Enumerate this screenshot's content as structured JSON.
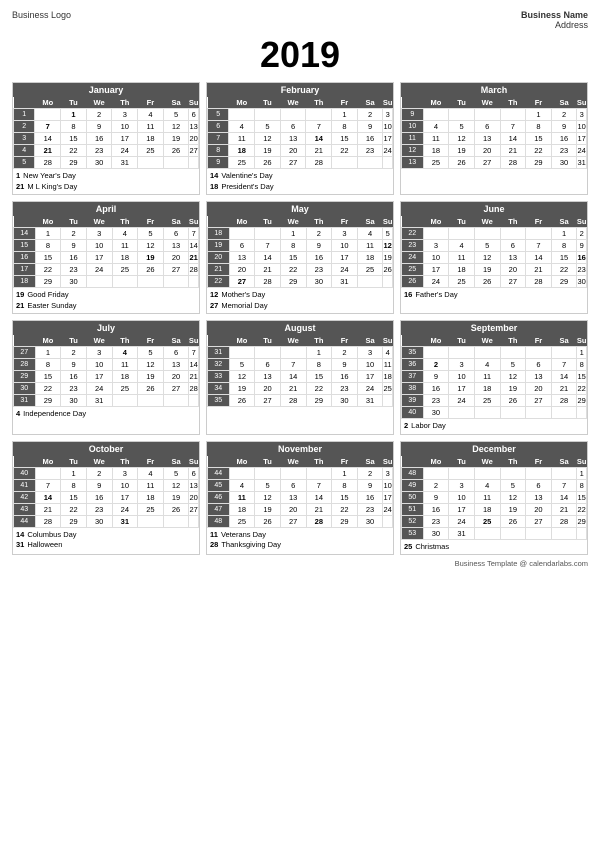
{
  "header": {
    "logo": "Business Logo",
    "name": "Business Name",
    "address": "Address",
    "year": "2019"
  },
  "footer": "Business Template @ calendarlabs.com",
  "months": [
    {
      "name": "January",
      "weeks": [
        [
          "",
          "Mo",
          "Tu",
          "We",
          "Th",
          "Fr",
          "Sa",
          "Su"
        ],
        [
          "1",
          "",
          "1",
          "2",
          "3",
          "4",
          "5",
          "6"
        ],
        [
          "2",
          "7",
          "8",
          "9",
          "10",
          "11",
          "12",
          "13"
        ],
        [
          "3",
          "14",
          "15",
          "16",
          "17",
          "18",
          "19",
          "20"
        ],
        [
          "4",
          "21",
          "22",
          "23",
          "24",
          "25",
          "26",
          "27"
        ],
        [
          "5",
          "28",
          "29",
          "30",
          "31",
          "",
          "",
          ""
        ]
      ],
      "holidays": [
        {
          "num": "1",
          "name": "New Year's Day"
        },
        {
          "num": "21",
          "name": "M L King's Day"
        }
      ]
    },
    {
      "name": "February",
      "weeks": [
        [
          "",
          "Mo",
          "Tu",
          "We",
          "Th",
          "Fr",
          "Sa",
          "Su"
        ],
        [
          "5",
          "",
          "",
          "",
          "",
          "1",
          "2",
          "3"
        ],
        [
          "6",
          "4",
          "5",
          "6",
          "7",
          "8",
          "9",
          "10"
        ],
        [
          "7",
          "11",
          "12",
          "13",
          "14",
          "15",
          "16",
          "17"
        ],
        [
          "8",
          "18",
          "19",
          "20",
          "21",
          "22",
          "23",
          "24"
        ],
        [
          "9",
          "25",
          "26",
          "27",
          "28",
          "",
          "",
          ""
        ]
      ],
      "holidays": [
        {
          "num": "14",
          "name": "Valentine's Day"
        },
        {
          "num": "18",
          "name": "President's Day"
        }
      ]
    },
    {
      "name": "March",
      "weeks": [
        [
          "",
          "Mo",
          "Tu",
          "We",
          "Th",
          "Fr",
          "Sa",
          "Su"
        ],
        [
          "9",
          "",
          "",
          "",
          "",
          "1",
          "2",
          "3"
        ],
        [
          "10",
          "4",
          "5",
          "6",
          "7",
          "8",
          "9",
          "10"
        ],
        [
          "11",
          "11",
          "12",
          "13",
          "14",
          "15",
          "16",
          "17"
        ],
        [
          "12",
          "18",
          "19",
          "20",
          "21",
          "22",
          "23",
          "24"
        ],
        [
          "13",
          "25",
          "26",
          "27",
          "28",
          "29",
          "30",
          "31"
        ]
      ],
      "holidays": []
    },
    {
      "name": "April",
      "weeks": [
        [
          "",
          "Mo",
          "Tu",
          "We",
          "Th",
          "Fr",
          "Sa",
          "Su"
        ],
        [
          "14",
          "1",
          "2",
          "3",
          "4",
          "5",
          "6",
          "7"
        ],
        [
          "15",
          "8",
          "9",
          "10",
          "11",
          "12",
          "13",
          "14"
        ],
        [
          "16",
          "15",
          "16",
          "17",
          "18",
          "19",
          "20",
          "21"
        ],
        [
          "17",
          "22",
          "23",
          "24",
          "25",
          "26",
          "27",
          "28"
        ],
        [
          "18",
          "29",
          "30",
          "",
          "",
          "",
          "",
          ""
        ]
      ],
      "holidays": [
        {
          "num": "19",
          "name": "Good Friday"
        },
        {
          "num": "21",
          "name": "Easter Sunday"
        }
      ]
    },
    {
      "name": "May",
      "weeks": [
        [
          "",
          "Mo",
          "Tu",
          "We",
          "Th",
          "Fr",
          "Sa",
          "Su"
        ],
        [
          "18",
          "",
          "",
          "1",
          "2",
          "3",
          "4",
          "5"
        ],
        [
          "19",
          "6",
          "7",
          "8",
          "9",
          "10",
          "11",
          "12"
        ],
        [
          "20",
          "13",
          "14",
          "15",
          "16",
          "17",
          "18",
          "19"
        ],
        [
          "21",
          "20",
          "21",
          "22",
          "23",
          "24",
          "25",
          "26"
        ],
        [
          "22",
          "27",
          "28",
          "29",
          "30",
          "31",
          "",
          ""
        ]
      ],
      "holidays": [
        {
          "num": "12",
          "name": "Mother's Day"
        },
        {
          "num": "27",
          "name": "Memorial Day"
        }
      ]
    },
    {
      "name": "June",
      "weeks": [
        [
          "",
          "Mo",
          "Tu",
          "We",
          "Th",
          "Fr",
          "Sa",
          "Su"
        ],
        [
          "22",
          "",
          "",
          "",
          "",
          "",
          "1",
          "2"
        ],
        [
          "23",
          "3",
          "4",
          "5",
          "6",
          "7",
          "8",
          "9"
        ],
        [
          "24",
          "10",
          "11",
          "12",
          "13",
          "14",
          "15",
          "16"
        ],
        [
          "25",
          "17",
          "18",
          "19",
          "20",
          "21",
          "22",
          "23"
        ],
        [
          "26",
          "24",
          "25",
          "26",
          "27",
          "28",
          "29",
          "30"
        ]
      ],
      "holidays": [
        {
          "num": "16",
          "name": "Father's Day"
        }
      ]
    },
    {
      "name": "July",
      "weeks": [
        [
          "",
          "Mo",
          "Tu",
          "We",
          "Th",
          "Fr",
          "Sa",
          "Su"
        ],
        [
          "27",
          "1",
          "2",
          "3",
          "4",
          "5",
          "6",
          "7"
        ],
        [
          "28",
          "8",
          "9",
          "10",
          "11",
          "12",
          "13",
          "14"
        ],
        [
          "29",
          "15",
          "16",
          "17",
          "18",
          "19",
          "20",
          "21"
        ],
        [
          "30",
          "22",
          "23",
          "24",
          "25",
          "26",
          "27",
          "28"
        ],
        [
          "31",
          "29",
          "30",
          "31",
          "",
          "",
          "",
          ""
        ]
      ],
      "holidays": [
        {
          "num": "4",
          "name": "Independence Day"
        }
      ]
    },
    {
      "name": "August",
      "weeks": [
        [
          "",
          "Mo",
          "Tu",
          "We",
          "Th",
          "Fr",
          "Sa",
          "Su"
        ],
        [
          "31",
          "",
          "",
          "",
          "1",
          "2",
          "3",
          "4"
        ],
        [
          "32",
          "5",
          "6",
          "7",
          "8",
          "9",
          "10",
          "11"
        ],
        [
          "33",
          "12",
          "13",
          "14",
          "15",
          "16",
          "17",
          "18"
        ],
        [
          "34",
          "19",
          "20",
          "21",
          "22",
          "23",
          "24",
          "25"
        ],
        [
          "35",
          "26",
          "27",
          "28",
          "29",
          "30",
          "31",
          ""
        ]
      ],
      "holidays": []
    },
    {
      "name": "September",
      "weeks": [
        [
          "",
          "Mo",
          "Tu",
          "We",
          "Th",
          "Fr",
          "Sa",
          "Su"
        ],
        [
          "35",
          "",
          "",
          "",
          "",
          "",
          "",
          "1"
        ],
        [
          "36",
          "2",
          "3",
          "4",
          "5",
          "6",
          "7",
          "8"
        ],
        [
          "37",
          "9",
          "10",
          "11",
          "12",
          "13",
          "14",
          "15"
        ],
        [
          "38",
          "16",
          "17",
          "18",
          "19",
          "20",
          "21",
          "22"
        ],
        [
          "39",
          "23",
          "24",
          "25",
          "26",
          "27",
          "28",
          "29"
        ],
        [
          "40",
          "30",
          "",
          "",
          "",
          "",
          "",
          ""
        ]
      ],
      "holidays": [
        {
          "num": "2",
          "name": "Labor Day"
        }
      ]
    },
    {
      "name": "October",
      "weeks": [
        [
          "",
          "Mo",
          "Tu",
          "We",
          "Th",
          "Fr",
          "Sa",
          "Su"
        ],
        [
          "40",
          "",
          "1",
          "2",
          "3",
          "4",
          "5",
          "6"
        ],
        [
          "41",
          "7",
          "8",
          "9",
          "10",
          "11",
          "12",
          "13"
        ],
        [
          "42",
          "14",
          "15",
          "16",
          "17",
          "18",
          "19",
          "20"
        ],
        [
          "43",
          "21",
          "22",
          "23",
          "24",
          "25",
          "26",
          "27"
        ],
        [
          "44",
          "28",
          "29",
          "30",
          "31",
          "",
          "",
          ""
        ]
      ],
      "holidays": [
        {
          "num": "14",
          "name": "Columbus Day"
        },
        {
          "num": "31",
          "name": "Halloween"
        }
      ]
    },
    {
      "name": "November",
      "weeks": [
        [
          "",
          "Mo",
          "Tu",
          "We",
          "Th",
          "Fr",
          "Sa",
          "Su"
        ],
        [
          "44",
          "",
          "",
          "",
          "",
          "1",
          "2",
          "3"
        ],
        [
          "45",
          "4",
          "5",
          "6",
          "7",
          "8",
          "9",
          "10"
        ],
        [
          "46",
          "11",
          "12",
          "13",
          "14",
          "15",
          "16",
          "17"
        ],
        [
          "47",
          "18",
          "19",
          "20",
          "21",
          "22",
          "23",
          "24"
        ],
        [
          "48",
          "25",
          "26",
          "27",
          "28",
          "29",
          "30",
          ""
        ]
      ],
      "holidays": [
        {
          "num": "11",
          "name": "Veterans Day"
        },
        {
          "num": "28",
          "name": "Thanksgiving Day"
        }
      ]
    },
    {
      "name": "December",
      "weeks": [
        [
          "",
          "Mo",
          "Tu",
          "We",
          "Th",
          "Fr",
          "Sa",
          "Su"
        ],
        [
          "48",
          "",
          "",
          "",
          "",
          "",
          "",
          "1"
        ],
        [
          "49",
          "2",
          "3",
          "4",
          "5",
          "6",
          "7",
          "8"
        ],
        [
          "50",
          "9",
          "10",
          "11",
          "12",
          "13",
          "14",
          "15"
        ],
        [
          "51",
          "16",
          "17",
          "18",
          "19",
          "20",
          "21",
          "22"
        ],
        [
          "52",
          "23",
          "24",
          "25",
          "26",
          "27",
          "28",
          "29"
        ],
        [
          "53",
          "30",
          "31",
          "",
          "",
          "",
          "",
          ""
        ]
      ],
      "holidays": [
        {
          "num": "25",
          "name": "Christmas"
        }
      ]
    }
  ]
}
